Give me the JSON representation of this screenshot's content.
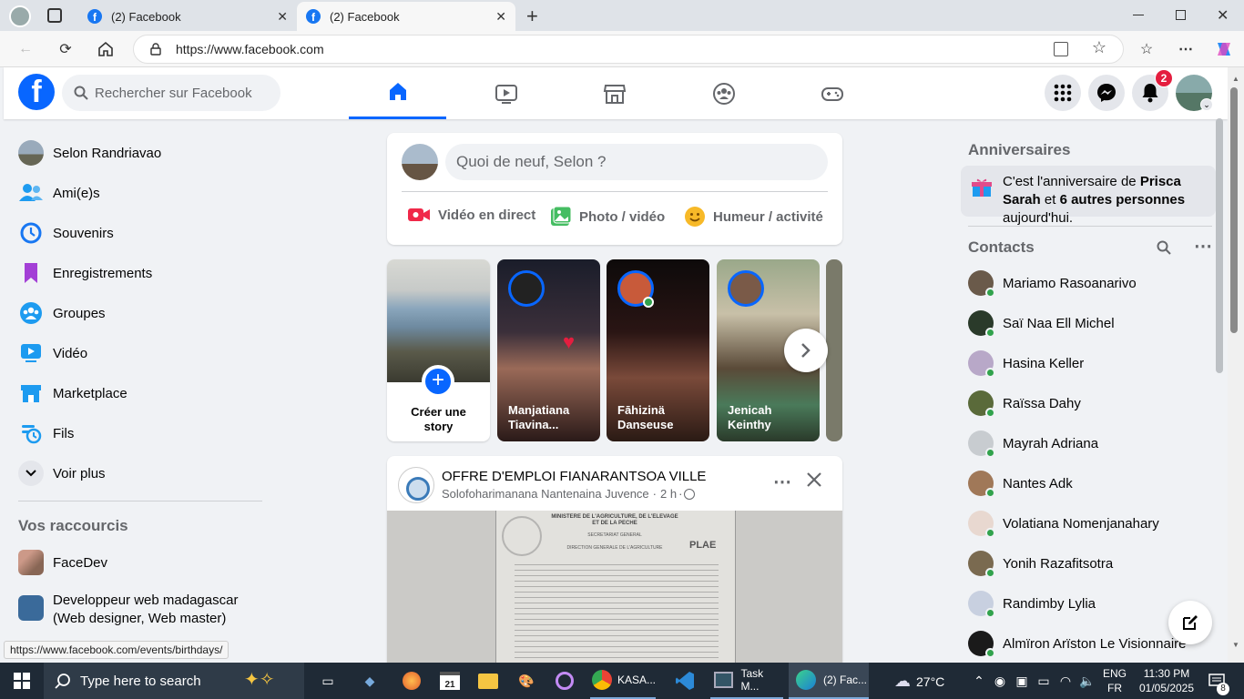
{
  "browser": {
    "tabs": [
      {
        "title": "(2) Facebook",
        "active": false
      },
      {
        "title": "(2) Facebook",
        "active": true
      }
    ],
    "url": "https://www.facebook.com",
    "status_url": "https://www.facebook.com/events/birthdays/"
  },
  "header": {
    "search_placeholder": "Rechercher sur Facebook",
    "notification_count": "2"
  },
  "left_sidebar": {
    "items": [
      {
        "label": "Selon Randriavao"
      },
      {
        "label": "Ami(e)s"
      },
      {
        "label": "Souvenirs"
      },
      {
        "label": "Enregistrements"
      },
      {
        "label": "Groupes"
      },
      {
        "label": "Vidéo"
      },
      {
        "label": "Marketplace"
      },
      {
        "label": "Fils"
      },
      {
        "label": "Voir plus"
      }
    ],
    "shortcuts_title": "Vos raccourcis",
    "shortcuts": [
      {
        "label": "FaceDev"
      },
      {
        "label": "Developpeur web madagascar (Web designer, Web master)"
      }
    ]
  },
  "composer": {
    "placeholder": "Quoi de neuf, Selon ?",
    "live_label": "Vidéo en direct",
    "photo_label": "Photo / vidéo",
    "feeling_label": "Humeur / activité"
  },
  "stories": [
    {
      "name": "Créer une story"
    },
    {
      "name": "Manjatiana Tiavina..."
    },
    {
      "name": "Fāhizinä Danseuse"
    },
    {
      "name": "Jenicah Keinthy"
    }
  ],
  "post": {
    "title": "OFFRE D'EMPLOI FIANARANTSOA VILLE",
    "author": "Solofoharimanana Nantenaina Juvence",
    "time": "2 h",
    "doc_line1": "MINISTERE DE L'AGRICULTURE, DE L'ELEVAGE ET DE LA PECHE",
    "doc_line2": "SECRETARIAT GENERAL",
    "doc_line3": "DIRECTION GENERALE DE L'AGRICULTURE",
    "doc_logo": "PLAE"
  },
  "right_sidebar": {
    "birthdays_title": "Anniversaires",
    "birthday_pre": "C'est l'anniversaire de ",
    "birthday_name": "Prisca Sarah",
    "birthday_mid": " et ",
    "birthday_others": "6 autres personnes",
    "birthday_post": " aujourd'hui.",
    "contacts_title": "Contacts",
    "contacts": [
      {
        "name": "Mariamo Rasoanarivo"
      },
      {
        "name": "Saï Naa Ell Michel"
      },
      {
        "name": "Hasina Keller"
      },
      {
        "name": "Raïssa Dahy"
      },
      {
        "name": "Mayrah Adriana"
      },
      {
        "name": "Nantes Adk"
      },
      {
        "name": "Volatiana Nomenjanahary"
      },
      {
        "name": "Yonih Razafitsotra"
      },
      {
        "name": "Randimby Lylia"
      },
      {
        "name": "Almïron Arïston Le Visionnaire"
      }
    ]
  },
  "taskbar": {
    "search_placeholder": "Type here to search",
    "apps": [
      {
        "label": "KASA..."
      },
      {
        "label": "Task M..."
      },
      {
        "label": "(2) Fac..."
      }
    ],
    "temperature": "27°C",
    "lang_top": "ENG",
    "lang_bottom": "FR",
    "time": "11:30 PM",
    "date": "01/05/2025",
    "notif_count": "8",
    "calendar_day": "21"
  }
}
